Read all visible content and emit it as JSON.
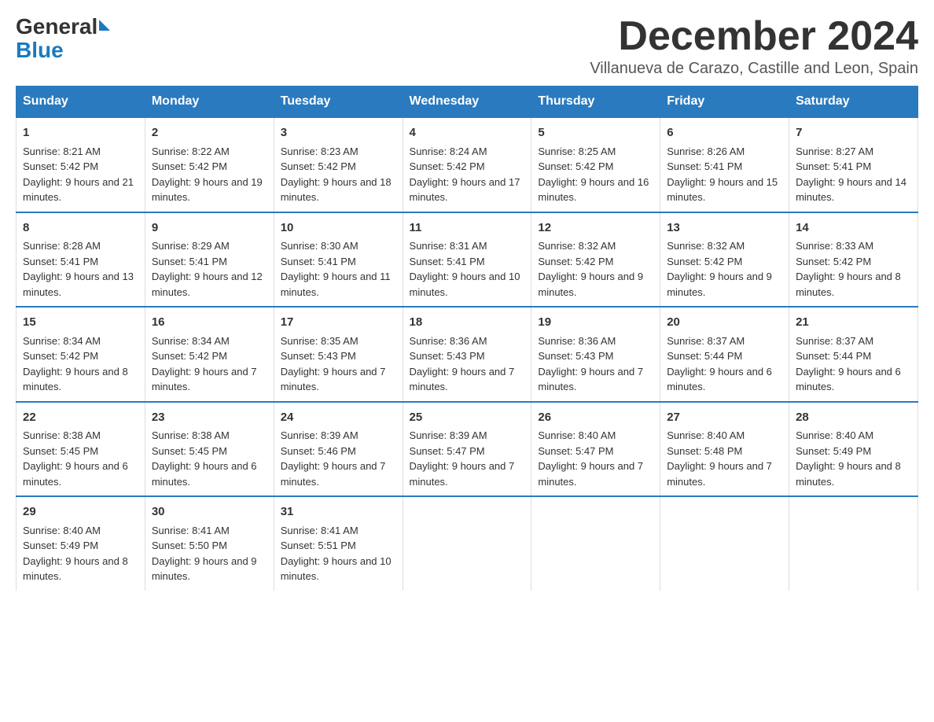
{
  "header": {
    "logo_general": "General",
    "logo_blue": "Blue",
    "month_title": "December 2024",
    "subtitle": "Villanueva de Carazo, Castille and Leon, Spain"
  },
  "weekdays": [
    "Sunday",
    "Monday",
    "Tuesday",
    "Wednesday",
    "Thursday",
    "Friday",
    "Saturday"
  ],
  "weeks": [
    [
      {
        "day": "1",
        "sunrise": "8:21 AM",
        "sunset": "5:42 PM",
        "daylight": "9 hours and 21 minutes."
      },
      {
        "day": "2",
        "sunrise": "8:22 AM",
        "sunset": "5:42 PM",
        "daylight": "9 hours and 19 minutes."
      },
      {
        "day": "3",
        "sunrise": "8:23 AM",
        "sunset": "5:42 PM",
        "daylight": "9 hours and 18 minutes."
      },
      {
        "day": "4",
        "sunrise": "8:24 AM",
        "sunset": "5:42 PM",
        "daylight": "9 hours and 17 minutes."
      },
      {
        "day": "5",
        "sunrise": "8:25 AM",
        "sunset": "5:42 PM",
        "daylight": "9 hours and 16 minutes."
      },
      {
        "day": "6",
        "sunrise": "8:26 AM",
        "sunset": "5:41 PM",
        "daylight": "9 hours and 15 minutes."
      },
      {
        "day": "7",
        "sunrise": "8:27 AM",
        "sunset": "5:41 PM",
        "daylight": "9 hours and 14 minutes."
      }
    ],
    [
      {
        "day": "8",
        "sunrise": "8:28 AM",
        "sunset": "5:41 PM",
        "daylight": "9 hours and 13 minutes."
      },
      {
        "day": "9",
        "sunrise": "8:29 AM",
        "sunset": "5:41 PM",
        "daylight": "9 hours and 12 minutes."
      },
      {
        "day": "10",
        "sunrise": "8:30 AM",
        "sunset": "5:41 PM",
        "daylight": "9 hours and 11 minutes."
      },
      {
        "day": "11",
        "sunrise": "8:31 AM",
        "sunset": "5:41 PM",
        "daylight": "9 hours and 10 minutes."
      },
      {
        "day": "12",
        "sunrise": "8:32 AM",
        "sunset": "5:42 PM",
        "daylight": "9 hours and 9 minutes."
      },
      {
        "day": "13",
        "sunrise": "8:32 AM",
        "sunset": "5:42 PM",
        "daylight": "9 hours and 9 minutes."
      },
      {
        "day": "14",
        "sunrise": "8:33 AM",
        "sunset": "5:42 PM",
        "daylight": "9 hours and 8 minutes."
      }
    ],
    [
      {
        "day": "15",
        "sunrise": "8:34 AM",
        "sunset": "5:42 PM",
        "daylight": "9 hours and 8 minutes."
      },
      {
        "day": "16",
        "sunrise": "8:34 AM",
        "sunset": "5:42 PM",
        "daylight": "9 hours and 7 minutes."
      },
      {
        "day": "17",
        "sunrise": "8:35 AM",
        "sunset": "5:43 PM",
        "daylight": "9 hours and 7 minutes."
      },
      {
        "day": "18",
        "sunrise": "8:36 AM",
        "sunset": "5:43 PM",
        "daylight": "9 hours and 7 minutes."
      },
      {
        "day": "19",
        "sunrise": "8:36 AM",
        "sunset": "5:43 PM",
        "daylight": "9 hours and 7 minutes."
      },
      {
        "day": "20",
        "sunrise": "8:37 AM",
        "sunset": "5:44 PM",
        "daylight": "9 hours and 6 minutes."
      },
      {
        "day": "21",
        "sunrise": "8:37 AM",
        "sunset": "5:44 PM",
        "daylight": "9 hours and 6 minutes."
      }
    ],
    [
      {
        "day": "22",
        "sunrise": "8:38 AM",
        "sunset": "5:45 PM",
        "daylight": "9 hours and 6 minutes."
      },
      {
        "day": "23",
        "sunrise": "8:38 AM",
        "sunset": "5:45 PM",
        "daylight": "9 hours and 6 minutes."
      },
      {
        "day": "24",
        "sunrise": "8:39 AM",
        "sunset": "5:46 PM",
        "daylight": "9 hours and 7 minutes."
      },
      {
        "day": "25",
        "sunrise": "8:39 AM",
        "sunset": "5:47 PM",
        "daylight": "9 hours and 7 minutes."
      },
      {
        "day": "26",
        "sunrise": "8:40 AM",
        "sunset": "5:47 PM",
        "daylight": "9 hours and 7 minutes."
      },
      {
        "day": "27",
        "sunrise": "8:40 AM",
        "sunset": "5:48 PM",
        "daylight": "9 hours and 7 minutes."
      },
      {
        "day": "28",
        "sunrise": "8:40 AM",
        "sunset": "5:49 PM",
        "daylight": "9 hours and 8 minutes."
      }
    ],
    [
      {
        "day": "29",
        "sunrise": "8:40 AM",
        "sunset": "5:49 PM",
        "daylight": "9 hours and 8 minutes."
      },
      {
        "day": "30",
        "sunrise": "8:41 AM",
        "sunset": "5:50 PM",
        "daylight": "9 hours and 9 minutes."
      },
      {
        "day": "31",
        "sunrise": "8:41 AM",
        "sunset": "5:51 PM",
        "daylight": "9 hours and 10 minutes."
      },
      null,
      null,
      null,
      null
    ]
  ]
}
